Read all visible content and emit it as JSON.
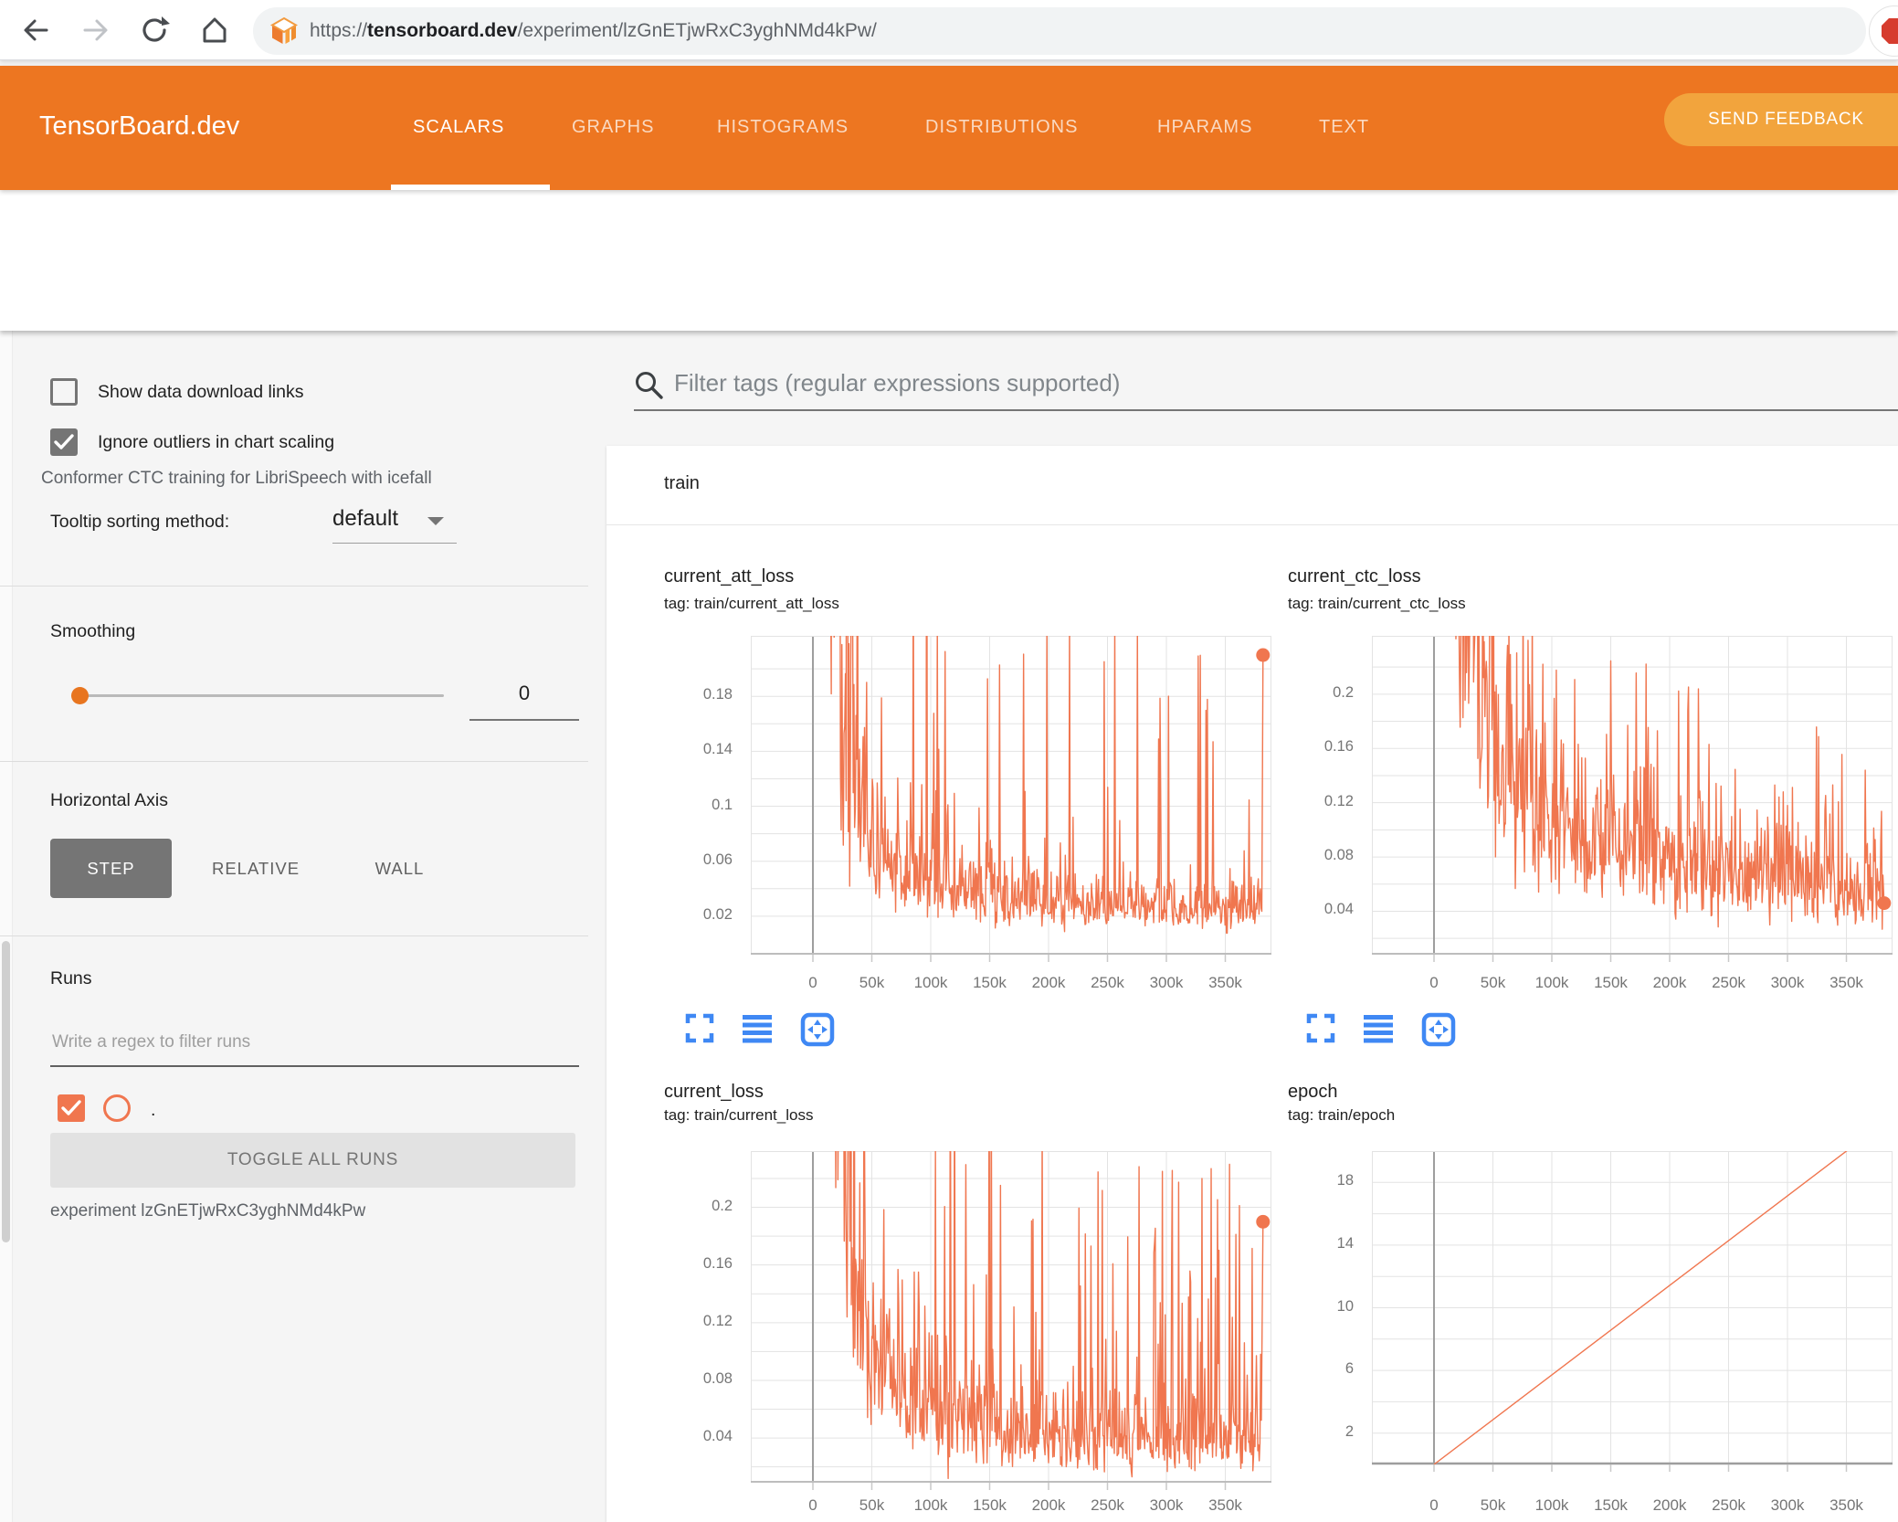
{
  "browser": {
    "url": {
      "protocol": "https://",
      "domain": "tensorboard.dev",
      "path": "/experiment/lzGnETjwRxC3yghNMd4kPw/"
    }
  },
  "header": {
    "brand": "TensorBoard.dev",
    "tabs": [
      {
        "label": "SCALARS",
        "active": true
      },
      {
        "label": "GRAPHS",
        "active": false
      },
      {
        "label": "HISTOGRAMS",
        "active": false
      },
      {
        "label": "DISTRIBUTIONS",
        "active": false
      },
      {
        "label": "HPARAMS",
        "active": false
      },
      {
        "label": "TEXT",
        "active": false
      }
    ],
    "feedback_label": "SEND FEEDBACK",
    "accent_color": "#ed7621",
    "feedback_color": "#f2a43d"
  },
  "subtitle": "Conformer CTC training for LibriSpeech with icefall",
  "sidebar": {
    "show_download": {
      "label": "Show data download links",
      "checked": false
    },
    "ignore_outliers": {
      "label": "Ignore outliers in chart scaling",
      "checked": true
    },
    "tooltip_sort": {
      "label": "Tooltip sorting method:",
      "value": "default"
    },
    "smoothing": {
      "label": "Smoothing",
      "value": "0"
    },
    "horizontal_axis": {
      "label": "Horizontal Axis",
      "options": [
        "STEP",
        "RELATIVE",
        "WALL"
      ],
      "selected": "STEP"
    },
    "runs": {
      "label": "Runs",
      "filter_placeholder": "Write a regex to filter runs",
      "items": [
        {
          "label": ".",
          "checked": true,
          "color": "#f0764f"
        }
      ],
      "toggle_label": "TOGGLE ALL RUNS",
      "experiment_label": "experiment lzGnETjwRxC3yghNMd4kPw"
    }
  },
  "main": {
    "filter_placeholder": "Filter tags (regular expressions supported)",
    "section_label": "train"
  },
  "icons": {
    "back-icon": "left-arrow",
    "forward-icon": "right-arrow",
    "reload-icon": "circular-arrow",
    "home-icon": "house",
    "tensorboard-favicon": "orange-cube-logo",
    "adblock-extension-icon": "red-octagon",
    "search-icon": "magnifier",
    "dropdown-caret-icon": "triangle-down",
    "checkmark-icon": "check",
    "expand-chart-icon": "corner-brackets",
    "toggle-log-y-icon": "four-bars",
    "fit-domain-icon": "boxed-arrows"
  },
  "chart_data": [
    {
      "id": "current_att_loss",
      "type": "line",
      "title": "current_att_loss",
      "subtitle": "tag: train/current_att_loss",
      "series_name": ".",
      "series_color": "#f0764f",
      "grid": true,
      "legend": "none",
      "x_ticks": [
        "0",
        "50k",
        "100k",
        "150k",
        "200k",
        "250k",
        "300k",
        "350k"
      ],
      "x_tick_values": [
        0,
        50000,
        100000,
        150000,
        200000,
        250000,
        300000,
        350000
      ],
      "x_range": [
        -52000,
        389000
      ],
      "y_labeled_ticks": [
        0.18,
        0.14,
        0.1,
        0.06,
        0.02
      ],
      "y_grid": {
        "min": 0.02,
        "max": 0.2,
        "step": 0.02
      },
      "y_range": [
        -0.008,
        0.224
      ],
      "trend": [
        [
          9000,
          0.6
        ],
        [
          18000,
          0.32
        ],
        [
          28000,
          0.18
        ],
        [
          38000,
          0.12
        ],
        [
          50000,
          0.085
        ],
        [
          65000,
          0.062
        ],
        [
          85000,
          0.05
        ],
        [
          110000,
          0.042
        ],
        [
          140000,
          0.036
        ],
        [
          180000,
          0.031
        ],
        [
          220000,
          0.028
        ],
        [
          260000,
          0.027
        ],
        [
          300000,
          0.027
        ],
        [
          340000,
          0.026
        ],
        [
          381000,
          0.026
        ]
      ],
      "noise": {
        "sigma": 0.42,
        "spike_prob": 0.055,
        "spike_lo": 2.5,
        "spike_hi": 9,
        "seed": 7
      },
      "x_start": 9000,
      "x_end": 381000,
      "x_step": 600,
      "end_dot": [
        382000,
        0.21
      ]
    },
    {
      "id": "current_ctc_loss",
      "type": "line",
      "title": "current_ctc_loss",
      "subtitle": "tag: train/current_ctc_loss",
      "series_name": ".",
      "series_color": "#f0764f",
      "grid": true,
      "legend": "none",
      "x_ticks": [
        "0",
        "50k",
        "100k",
        "150k",
        "200k",
        "250k",
        "300k",
        "350k"
      ],
      "x_tick_values": [
        0,
        50000,
        100000,
        150000,
        200000,
        250000,
        300000,
        350000
      ],
      "x_range": [
        -52000,
        389000
      ],
      "y_labeled_ticks": [
        0.2,
        0.16,
        0.12,
        0.08,
        0.04
      ],
      "y_grid": {
        "min": 0.02,
        "max": 0.22,
        "step": 0.02
      },
      "y_range": [
        0.008,
        0.243
      ],
      "trend": [
        [
          6000,
          0.7
        ],
        [
          20000,
          0.35
        ],
        [
          30000,
          0.26
        ],
        [
          40000,
          0.2
        ],
        [
          55000,
          0.16
        ],
        [
          70000,
          0.13
        ],
        [
          90000,
          0.11
        ],
        [
          120000,
          0.095
        ],
        [
          160000,
          0.085
        ],
        [
          200000,
          0.075
        ],
        [
          250000,
          0.068
        ],
        [
          300000,
          0.062
        ],
        [
          340000,
          0.058
        ],
        [
          381000,
          0.052
        ]
      ],
      "noise": {
        "sigma": 0.33,
        "spike_prob": 0.045,
        "spike_lo": 1.7,
        "spike_hi": 3.0,
        "seed": 11
      },
      "x_start": 6000,
      "x_end": 381000,
      "x_step": 600,
      "end_dot": [
        382000,
        0.046
      ]
    },
    {
      "id": "current_loss",
      "type": "line",
      "title": "current_loss",
      "subtitle": "tag: train/current_loss",
      "series_name": ".",
      "series_color": "#f0764f",
      "grid": true,
      "legend": "none",
      "x_ticks": [
        "0",
        "50k",
        "100k",
        "150k",
        "200k",
        "250k",
        "300k",
        "350k"
      ],
      "x_tick_values": [
        0,
        50000,
        100000,
        150000,
        200000,
        250000,
        300000,
        350000
      ],
      "x_range": [
        -52000,
        389000
      ],
      "y_labeled_ticks": [
        0.2,
        0.16,
        0.12,
        0.08,
        0.04
      ],
      "y_grid": {
        "min": 0.02,
        "max": 0.22,
        "step": 0.02
      },
      "y_range": [
        0.009,
        0.239
      ],
      "trend": [
        [
          8000,
          0.65
        ],
        [
          18000,
          0.35
        ],
        [
          28000,
          0.2
        ],
        [
          38000,
          0.14
        ],
        [
          50000,
          0.1
        ],
        [
          65000,
          0.08
        ],
        [
          85000,
          0.065
        ],
        [
          110000,
          0.055
        ],
        [
          140000,
          0.048
        ],
        [
          180000,
          0.043
        ],
        [
          220000,
          0.04
        ],
        [
          260000,
          0.038
        ],
        [
          300000,
          0.038
        ],
        [
          340000,
          0.036
        ],
        [
          381000,
          0.037
        ]
      ],
      "noise": {
        "sigma": 0.4,
        "spike_prob": 0.06,
        "spike_lo": 2.2,
        "spike_hi": 6.5,
        "seed": 23
      },
      "x_start": 8000,
      "x_end": 381000,
      "x_step": 600,
      "end_dot": [
        382000,
        0.19
      ]
    },
    {
      "id": "epoch",
      "type": "line",
      "title": "epoch",
      "subtitle": "tag: train/epoch",
      "series_name": ".",
      "series_color": "#f0764f",
      "grid": true,
      "legend": "none",
      "x_ticks": [
        "0",
        "50k",
        "100k",
        "150k",
        "200k",
        "250k",
        "300k",
        "350k"
      ],
      "x_tick_values": [
        0,
        50000,
        100000,
        150000,
        200000,
        250000,
        300000,
        350000
      ],
      "x_range": [
        -52000,
        389000
      ],
      "y_labeled_ticks": [
        18,
        14,
        10,
        6,
        2
      ],
      "y_grid": {
        "min": 2,
        "max": 20,
        "step": 2
      },
      "y_range": [
        0,
        20
      ],
      "zero_baseline": true,
      "points": [
        [
          0,
          0
        ],
        [
          385000,
          22
        ]
      ]
    }
  ]
}
